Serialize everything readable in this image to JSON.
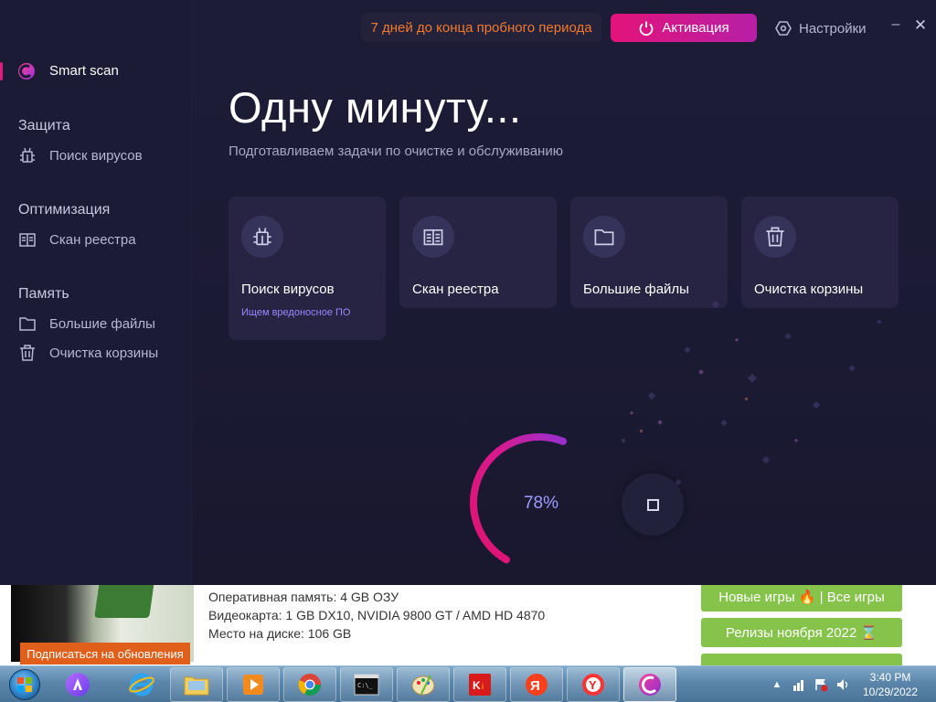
{
  "app": {
    "sidebar": {
      "smart_scan": "Smart scan",
      "sections": [
        {
          "title": "Защита",
          "items": [
            {
              "label": "Поиск вирусов",
              "icon": "bug-icon"
            }
          ]
        },
        {
          "title": "Оптимизация",
          "items": [
            {
              "label": "Скан реестра",
              "icon": "registry-book-icon"
            }
          ]
        },
        {
          "title": "Память",
          "items": [
            {
              "label": "Большие файлы",
              "icon": "folder-icon"
            },
            {
              "label": "Очистка корзины",
              "icon": "trash-icon"
            }
          ]
        }
      ]
    },
    "header": {
      "trial_text": "7 дней до конца пробного периода",
      "activate_label": "Активация",
      "settings_label": "Настройки",
      "minimize": "–",
      "close": "✕"
    },
    "main": {
      "headline": "Одну минуту...",
      "subheadline": "Подготавливаем задачи по очистке и обслуживанию",
      "cards": [
        {
          "title": "Поиск вирусов",
          "subtitle": "Ищем вредоносное ПО",
          "icon": "bug-icon",
          "active": true
        },
        {
          "title": "Скан реестра",
          "subtitle": "",
          "icon": "registry-book-icon",
          "active": false
        },
        {
          "title": "Большие файлы",
          "subtitle": "",
          "icon": "folder-icon",
          "active": false
        },
        {
          "title": "Очистка корзины",
          "subtitle": "",
          "icon": "trash-icon",
          "active": false
        }
      ],
      "progress_value": 78,
      "progress_text": "78%"
    },
    "colors": {
      "accent": "#e01c7f",
      "accent2": "#b61fa6",
      "trial": "#f07a2e",
      "subtitle": "#9a86ff",
      "progress_text": "#9f9cff"
    }
  },
  "webpage": {
    "subscribe_label": "Подписаться на обновления",
    "specs": [
      "Оперативная память: 4 GB ОЗУ",
      "Видеокарта: 1 GB DX10, NVIDIA 9800 GT / AMD HD 4870",
      "Место на диске: 106 GB"
    ],
    "buttons": [
      "Новые игры 🔥 | Все игры",
      "Релизы ноября 2022 ⌛"
    ]
  },
  "taskbar": {
    "apps": [
      "alice-voice-icon",
      "ie-icon",
      "explorer-folder-icon",
      "media-player-icon",
      "chrome-icon",
      "cmd-icon",
      "paint-icon",
      "kl-icon",
      "yandex-icon",
      "yandex-browser-icon",
      "cleaner-app-icon"
    ],
    "time": "3:40 PM",
    "date": "10/29/2022"
  },
  "chart_data": {
    "type": "gauge",
    "value": 78,
    "max": 100,
    "label": "78%"
  }
}
